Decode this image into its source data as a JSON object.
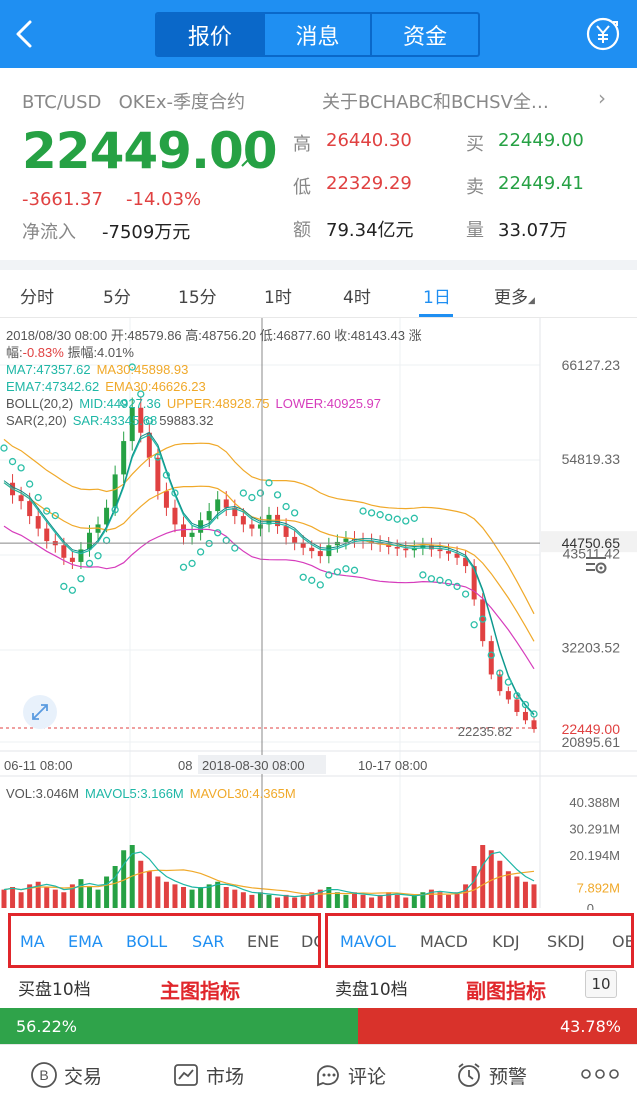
{
  "header": {
    "tabs": [
      {
        "label": "报价",
        "active": true
      },
      {
        "label": "消息",
        "active": false
      },
      {
        "label": "资金",
        "active": false
      }
    ]
  },
  "ticker": {
    "pair": "BTC/USD",
    "market": "OKEx-季度合约",
    "news": "关于BCHABC和BCHSV全…",
    "price": "22449.00",
    "change": "-3661.37",
    "change_pct": "-14.03%",
    "net_flow_label": "净流入",
    "net_flow_value": "-7509万元",
    "stats": {
      "high_label": "高",
      "high": "26440.30",
      "low_label": "低",
      "low": "22329.29",
      "amount_label": "额",
      "amount": "79.34亿元",
      "buy_label": "买",
      "buy": "22449.00",
      "sell_label": "卖",
      "sell": "22449.41",
      "volume_label": "量",
      "volume": "33.07万"
    }
  },
  "period_tabs": [
    "分时",
    "5分",
    "15分",
    "1时",
    "4时",
    "1日",
    "更多"
  ],
  "active_period": "1日",
  "chart_info": {
    "line1": "2018/08/30 08:00 开:48579.86 高:48756.20 低:46877.60 收:48143.43 涨",
    "line2_label": "幅:",
    "line2_chg": "-0.83%",
    "line2_rest": " 振幅:4.01%",
    "ma7": "MA7:47357.62",
    "ma30": "MA30:45898.93",
    "ema7": "EMA7:47342.62",
    "ema30": "EMA30:46626.23",
    "boll": "BOLL(20,2)",
    "mid": "MID:44927.36",
    "upper": "UPPER:48928.75",
    "lower": "LOWER:40925.97",
    "sar_label": "SAR(2,20)",
    "sar": "SAR:43345.68",
    "sar_extra": "59883.32",
    "vol": "VOL:3.046M",
    "mavol5": "MAVOL5:3.166M",
    "mavol30": "MAVOL30:4.365M"
  },
  "y_axis_main": [
    "66127.23",
    "54819.33",
    "44750.65",
    "43511.42",
    "32203.52",
    "22449.00",
    "20895.61"
  ],
  "crosshair_price": "44750.65",
  "last_price_tag": "22449.00",
  "low_marker": "22235.82",
  "x_axis": [
    "06-11 08:00",
    "08",
    "2018-08-30 08:00",
    "10-17 08:00"
  ],
  "y_axis_vol": [
    "40.388M",
    "30.291M",
    "20.194M",
    "7.892M",
    "0"
  ],
  "main_indicators": [
    "MA",
    "EMA",
    "BOLL",
    "SAR",
    "ENE",
    "DC"
  ],
  "sub_indicators": [
    "MAVOL",
    "MACD",
    "KDJ",
    "SKDJ",
    "OB"
  ],
  "annotations": {
    "main": "主图指标",
    "sub": "副图指标"
  },
  "depth": {
    "buy_label": "买盘10档",
    "sell_label": "卖盘10档",
    "level": "10",
    "buy_pct": "56.22%",
    "sell_pct": "43.78%",
    "buy_ratio": 0.5622
  },
  "bottom_nav": [
    "交易",
    "市场",
    "评论",
    "预警"
  ],
  "colors": {
    "brand": "#1f8ff2",
    "up": "#26a144",
    "down": "#e04141",
    "annotation": "#e0262b"
  },
  "chart_data": {
    "type": "candlestick",
    "x": [
      "06-11 08:00",
      "2018-08-30 08:00",
      "10-17 08:00"
    ],
    "ylim": [
      20895.61,
      66127.23
    ],
    "close_series": [
      52000,
      50500,
      49800,
      48000,
      46500,
      45000,
      44500,
      43000,
      42500,
      44000,
      46000,
      47000,
      49000,
      53000,
      57000,
      61000,
      58000,
      55000,
      51000,
      49000,
      47000,
      45500,
      46000,
      47500,
      48600,
      50000,
      49000,
      48000,
      47000,
      46500,
      47000,
      48143,
      46800,
      45500,
      44800,
      44200,
      43800,
      43200,
      44500,
      44900,
      45300,
      45100,
      45000,
      44800,
      44600,
      44300,
      44100,
      43900,
      44200,
      44500,
      44000,
      43800,
      43500,
      43000,
      42000,
      38000,
      33000,
      29000,
      27000,
      26000,
      24500,
      23500,
      22449
    ],
    "vol_ylim": [
      0,
      40.388
    ],
    "volume_series": [
      7,
      8,
      6,
      9,
      10,
      8,
      7,
      6,
      9,
      11,
      8,
      7,
      12,
      16,
      22,
      24,
      18,
      14,
      12,
      10,
      9,
      8,
      7,
      8,
      9,
      10,
      8,
      7,
      6,
      5,
      6,
      5,
      4,
      5,
      4,
      5,
      6,
      7,
      8,
      6,
      5,
      6,
      5,
      4,
      5,
      6,
      5,
      4,
      5,
      6,
      7,
      6,
      5,
      6,
      9,
      16,
      24,
      22,
      18,
      14,
      12,
      10,
      9
    ]
  }
}
